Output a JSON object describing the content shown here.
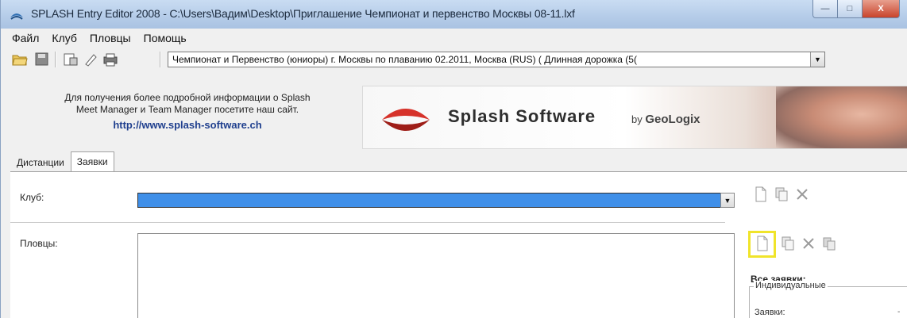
{
  "window": {
    "title": "SPLASH Entry Editor 2008 - C:\\Users\\Вадим\\Desktop\\Приглашение Чемпионат и первенство Москвы 08-11.lxf",
    "buttons": {
      "minimize": "—",
      "maximize": "□",
      "close": "X"
    }
  },
  "menu": {
    "items": [
      "Файл",
      "Клуб",
      "Пловцы",
      "Помощь"
    ]
  },
  "toolbar": {
    "icons": [
      "open-folder-icon",
      "save-icon",
      "properties-icon",
      "edit-pen-icon",
      "print-icon"
    ],
    "meet_select_value": "Чемпионат и Первенство (юниоры) г. Москвы по плаванию 02.2011,  Москва  (RUS)  ( Длинная дорожка (5(",
    "meet_select_arrow": "▼"
  },
  "banner": {
    "info_line1": "Для получения более подробной информации о Splash",
    "info_line2": "Meet Manager и Team Manager посетите наш сайт.",
    "link": "http://www.splash-software.ch",
    "logo_title": "Splash Software",
    "logo_by": "by",
    "logo_company": "GeoLogix"
  },
  "tabs": [
    {
      "label": "Дистанции",
      "active": false
    },
    {
      "label": "Заявки",
      "active": true
    }
  ],
  "form": {
    "club_label": "Клуб:",
    "club_value": "",
    "club_arrow": "▼",
    "swimmers_label": "Пловцы:"
  },
  "actions": {
    "club": [
      "new-document-icon",
      "copy-document-icon",
      "delete-x-icon"
    ],
    "swimmers": [
      "new-document-icon",
      "copy-document-icon",
      "delete-x-icon",
      "duplicate-icon"
    ]
  },
  "summary": {
    "title": "Все заявки:",
    "group_label": "Индивидуальные",
    "row_label": "Заявки:",
    "row_arrow": "-"
  },
  "colors": {
    "title_bar": "#b6cde9",
    "club_select_fill": "#3f8fe8",
    "highlight": "#f0e42a",
    "link": "#1f3f8e"
  }
}
